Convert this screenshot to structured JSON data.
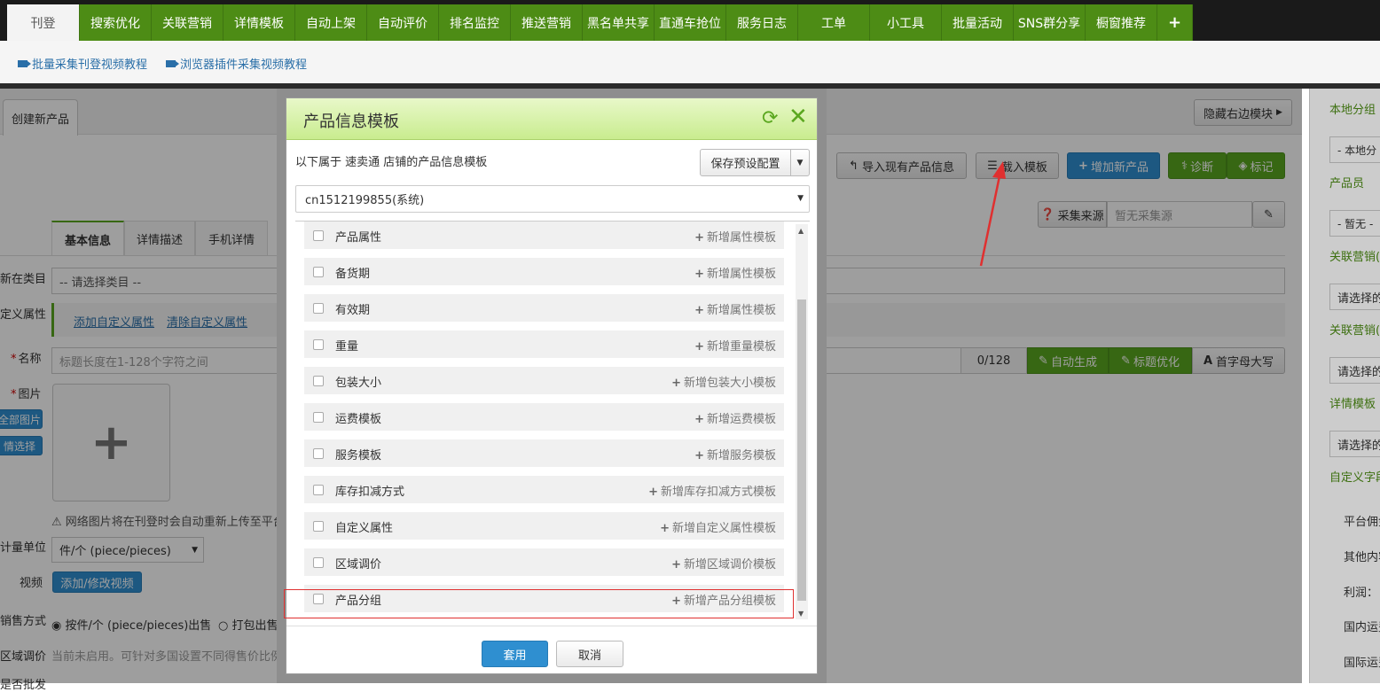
{
  "nav": {
    "tabs": [
      "刊登",
      "搜索优化",
      "关联营销",
      "详情模板",
      "自动上架",
      "自动评价",
      "排名监控",
      "推送营销",
      "黑名单共享",
      "直通车抢位",
      "服务日志",
      "工单",
      "小工具",
      "批量活动",
      "SNS群分享",
      "橱窗推荐"
    ],
    "add": "+"
  },
  "subnav": {
    "links": [
      "批量采集刊登视频教程",
      "浏览器插件采集视频教程"
    ]
  },
  "page": {
    "create_tab": "创建新产品",
    "hide_right": "隐藏右边模块",
    "import_btn": "导入现有产品信息",
    "load_btn": "载入模板",
    "add_btn": "增加新产品",
    "diag_btn": "诊断",
    "mark_btn": "标记",
    "source_label": "采集来源",
    "source_placeholder": "暂无采集源",
    "tabs": [
      "基本信息",
      "详情描述",
      "手机详情"
    ],
    "category_label": "新在类目",
    "category_value": "-- 请选择类目 --",
    "custom_attr_label": "定义属性",
    "add_custom": "添加自定义属性",
    "clear_custom": "清除自定义属性",
    "name_label": "名称",
    "name_placeholder": "标题长度在1-128个字符之间",
    "name_count": "0/128",
    "auto_gen": "自动生成",
    "title_opt": "标题优化",
    "capitalize": "首字母大写",
    "image_label": "图片",
    "all_images": "全部图片",
    "select_img": "情选择",
    "image_note": "网络图片将在刊登时会自动重新上传至平台",
    "unit_label": "计量单位",
    "unit_value": "件/个 (piece/pieces)",
    "video_label": "视频",
    "video_btn": "添加/修改视频",
    "sale_label": "销售方式",
    "sale_opt1": "按件/个 (piece/pieces)出售",
    "sale_opt2": "打包出售",
    "region_label": "区域调价",
    "region_note": "当前未启用。可针对多国设置不同得售价比例。",
    "bulk_label": "是否批发"
  },
  "right": {
    "local_group": "本地分组",
    "local_group_value": "- 本地分",
    "staff": "产品员",
    "staff_value": "- 暂无 -",
    "related1": "关联营销(",
    "related1_value": "请选择的",
    "related2": "关联营销(",
    "related2_value": "请选择的",
    "detail_tpl": "详情模板",
    "detail_value": "请选择的",
    "custom_fields": "自定义字段",
    "platform_fee": "平台佣金",
    "other": "其他内容",
    "profit": "利润：",
    "domestic": "国内运费",
    "intl": "国际运费"
  },
  "modal": {
    "title": "产品信息模板",
    "note": "以下属于 速卖通 店铺的产品信息模板",
    "save_preset": "保存预设配置",
    "select_value": "cn1512199855(系统)",
    "rows": [
      {
        "name": "产品属性",
        "action": "新增属性模板"
      },
      {
        "name": "备货期",
        "action": "新增属性模板"
      },
      {
        "name": "有效期",
        "action": "新增属性模板"
      },
      {
        "name": "重量",
        "action": "新增重量模板"
      },
      {
        "name": "包装大小",
        "action": "新增包装大小模板"
      },
      {
        "name": "运费模板",
        "action": "新增运费模板"
      },
      {
        "name": "服务模板",
        "action": "新增服务模板"
      },
      {
        "name": "库存扣减方式",
        "action": "新增库存扣减方式模板"
      },
      {
        "name": "自定义属性",
        "action": "新增自定义属性模板"
      },
      {
        "name": "区域调价",
        "action": "新增区域调价模板"
      },
      {
        "name": "产品分组",
        "action": "新增产品分组模板"
      }
    ],
    "apply": "套用",
    "cancel": "取消"
  },
  "colors": {
    "nav_green": "#4d8c15",
    "accent_blue": "#2f8fd0",
    "highlight_red": "#e03030"
  }
}
